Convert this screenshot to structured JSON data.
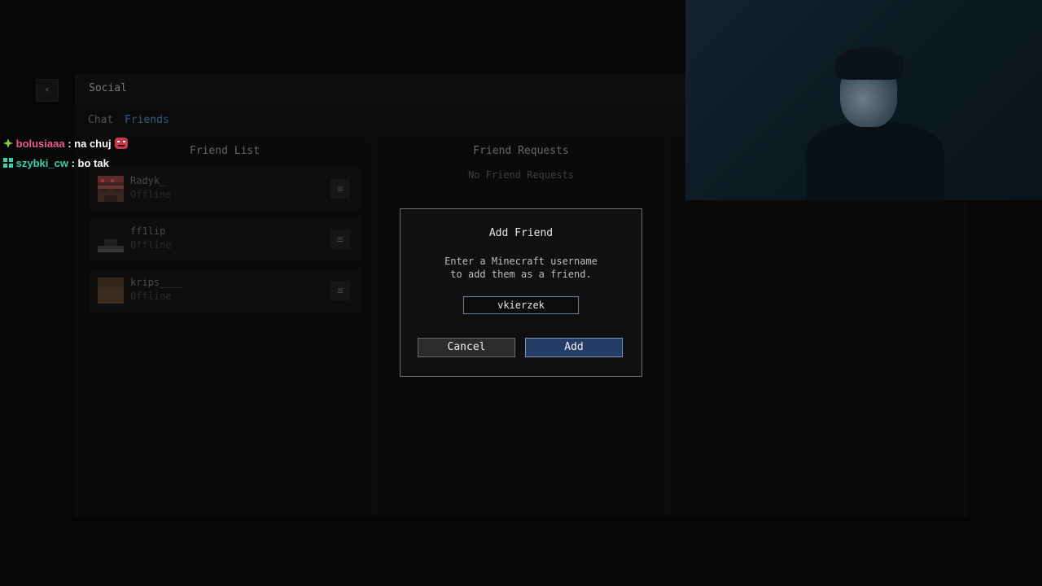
{
  "window": {
    "back_icon": "‹",
    "title": "Social"
  },
  "tabs": [
    {
      "label": "Chat",
      "active": false
    },
    {
      "label": "Friends",
      "active": true
    }
  ],
  "friend_list": {
    "title": "Friend List",
    "menu_icon": "≡",
    "friends": [
      {
        "name": "Radyk_",
        "status": "Offline"
      },
      {
        "name": "ff1lip",
        "status": "Offline"
      },
      {
        "name": "krips____",
        "status": "Offline"
      }
    ]
  },
  "friend_requests": {
    "title": "Friend Requests",
    "empty_text": "No Friend Requests"
  },
  "chat_overlay": [
    {
      "user": "bolusiaaa",
      "message": ": na chuj"
    },
    {
      "user": "szybki_cw",
      "message": ": bo tak"
    }
  ],
  "modal": {
    "title": "Add Friend",
    "description_line1": "Enter a Minecraft username",
    "description_line2": "to add them as a friend.",
    "input_value": "vkierzek",
    "cancel_label": "Cancel",
    "add_label": "Add"
  },
  "colors": {
    "accent": "#2f5d87",
    "add_button": "#253d66",
    "chat_user_1": "#e85d8e",
    "chat_user_2": "#3ad0b0"
  }
}
